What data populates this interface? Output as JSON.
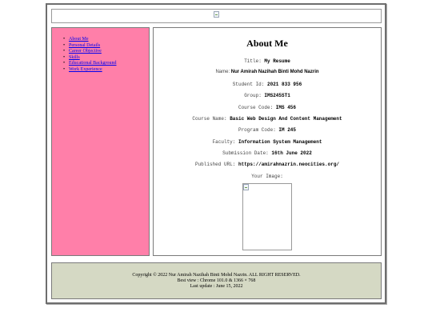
{
  "nav": {
    "items": [
      {
        "label": "About Me"
      },
      {
        "label": "Personal Details"
      },
      {
        "label": "Career Objective"
      },
      {
        "label": "Skills"
      },
      {
        "label": "Educational Background"
      },
      {
        "label": "Work Experience"
      }
    ]
  },
  "main": {
    "heading": "About Me",
    "fields": {
      "title": {
        "label": "Title:",
        "value": "My Resume"
      },
      "name": {
        "label": "Name:",
        "value": "Nur Amirah Nazihah Binti Mohd Nazrin"
      },
      "student_id": {
        "label": "Student Id:",
        "value": "2021 833 956"
      },
      "group": {
        "label": "Group:",
        "value": "IMS245ST1"
      },
      "course_code": {
        "label": "Course Code:",
        "value": "IMS 456"
      },
      "course_name": {
        "label": "Course Name:",
        "value": "Basic Web Design And Content Management"
      },
      "program_code": {
        "label": "Program Code:",
        "value": "IM 245"
      },
      "faculty": {
        "label": "Faculty:",
        "value": "Information System Management"
      },
      "submission_date": {
        "label": "Submission Date:",
        "value": "16th June 2022"
      },
      "published_url": {
        "label": "Published URL:",
        "value": "https://amirahnazrin.neocities.org/"
      },
      "your_image": {
        "label": "Your Image:"
      }
    }
  },
  "footer": {
    "copyright": "Copyright © 2022 Nur Amirah Nazihah Binti Mohd Nazrin. ALL RIGHT RESERVED.",
    "best_view": "Best view : Chrome 101.0 & 1366 × 768",
    "last_update": "Last update : June 15, 2022"
  },
  "colors": {
    "sidebar_bg": "#ff7fa9",
    "footer_bg": "#d5d9c4",
    "link": "#0000ee",
    "border": "#7a7a7a"
  }
}
